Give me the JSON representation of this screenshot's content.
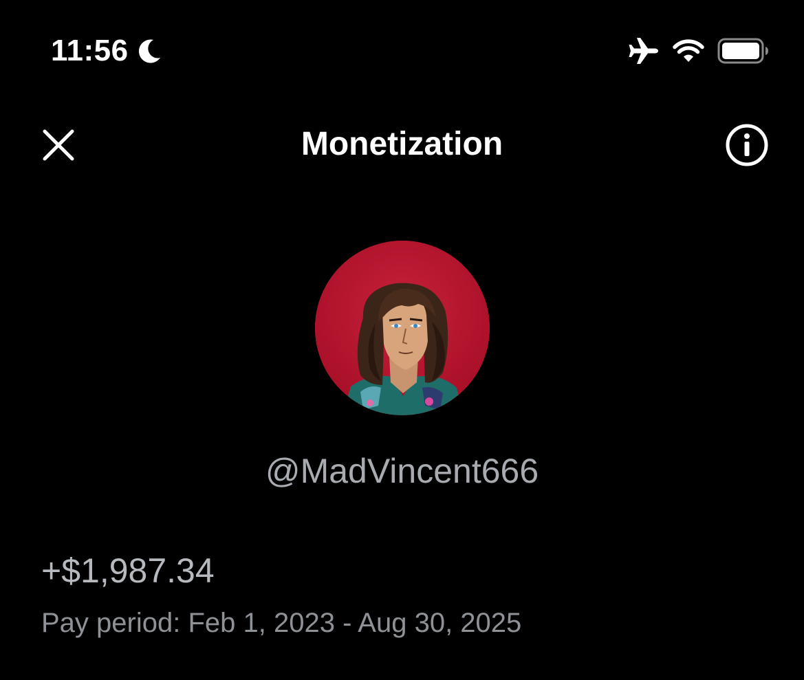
{
  "status_bar": {
    "time": "11:56",
    "icons": [
      "moon-icon",
      "airplane-icon",
      "wifi-icon",
      "battery-icon"
    ]
  },
  "nav": {
    "title": "Monetization",
    "left_icon": "close-icon",
    "right_icon": "info-icon"
  },
  "profile": {
    "username": "@MadVincent666",
    "avatar_background": "#b8122e"
  },
  "earnings": {
    "amount": "+$1,987.34",
    "pay_period": "Pay period: Feb 1, 2023 - Aug 30, 2025"
  },
  "colors": {
    "background": "#000000",
    "primary_text": "#ffffff",
    "secondary_text": "#a8acb1",
    "muted_text": "#8e9297"
  }
}
